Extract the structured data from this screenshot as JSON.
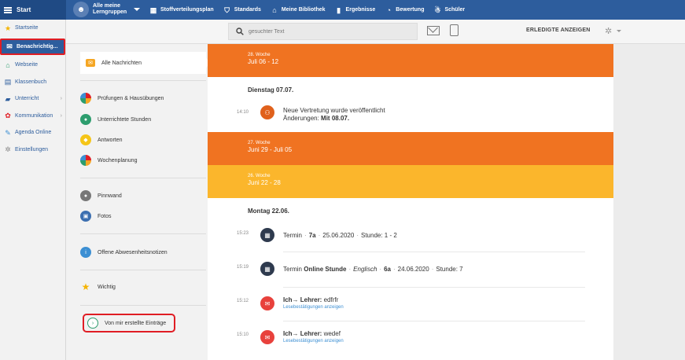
{
  "topbar": {
    "start_label": "Start",
    "gruppen_line1": "Alle meine",
    "gruppen_line2": "Lerngruppen",
    "nav": [
      {
        "label": "Stoffverteilungsplan",
        "icon": "grid-icon"
      },
      {
        "label": "Standards",
        "icon": "shield-icon"
      },
      {
        "label": "Meine Bibliothek",
        "icon": "library-icon"
      },
      {
        "label": "Ergebnisse",
        "icon": "bar-chart-icon"
      },
      {
        "label": "Bewertung",
        "icon": "gauge-icon"
      },
      {
        "label": "Schüler",
        "icon": "students-icon"
      }
    ]
  },
  "sidebar": {
    "items": [
      {
        "label": "Startseite",
        "icon": "star-icon"
      },
      {
        "label": "Benachrichtig...",
        "icon": "envelope-icon"
      },
      {
        "label": "Webseite",
        "icon": "home-icon"
      },
      {
        "label": "Klassenbuch",
        "icon": "book-icon"
      },
      {
        "label": "Unterricht",
        "icon": "folder-icon"
      },
      {
        "label": "Kommunikation",
        "icon": "chat-icon"
      },
      {
        "label": "Agenda Online",
        "icon": "pen-icon"
      },
      {
        "label": "Einstellungen",
        "icon": "gear-icon"
      }
    ]
  },
  "toolbar": {
    "search_placeholder": "gesuchter Text",
    "erledigte": "ERLEDIGTE ANZEIGEN"
  },
  "filters": [
    {
      "label": "Alle Nachrichten"
    },
    {
      "label": "Prüfungen & Hausübungen"
    },
    {
      "label": "Unterrichtete Stunden"
    },
    {
      "label": "Antworten"
    },
    {
      "label": "Wochenplanung"
    },
    {
      "label": "Pinnwand"
    },
    {
      "label": "Fotos"
    },
    {
      "label": "Offene Abwesenheitsnotizen"
    },
    {
      "label": "Wichtig"
    },
    {
      "label": "Von mir erstellte Einträge"
    }
  ],
  "feed": {
    "week28": {
      "label": "28. Woche",
      "range": "Juli 06 - 12"
    },
    "day1": "Dienstag 07.07.",
    "entry1": {
      "time": "14:10",
      "line1": "Neue Vertretung wurde veröffentlicht",
      "line2a": "Änderungen: ",
      "line2b": "Mit 08.07."
    },
    "week27": {
      "label": "27. Woche",
      "range": "Juni 29 - Juli 05"
    },
    "week26": {
      "label": "26. Woche",
      "range": "Juni 22 - 28"
    },
    "day2": "Montag 22.06.",
    "entry2": {
      "time": "15:23",
      "t1": "Termin",
      "t2": "7a",
      "t3": "25.06.2020",
      "t4": "Stunde: 1 - 2"
    },
    "entry3": {
      "time": "15:19",
      "t1": "Termin",
      "t2": "Online Stunde",
      "t3": "Englisch",
      "t4": "6a",
      "t5": "24.06.2020",
      "t6": "Stunde: 7"
    },
    "entry4": {
      "time": "15:12",
      "who": "Ich→ Lehrer:",
      "msg": " edfrfr",
      "sub": "Lesebestätigungen anzeigen"
    },
    "entry5": {
      "time": "15:10",
      "who": "Ich→ Lehrer:",
      "msg": " wedef",
      "sub": "Lesebestätigungen anzeigen"
    }
  },
  "colors": {
    "navy": "#2d5d9d",
    "orange": "#f07321",
    "amber": "#fbb62c",
    "red": "#e01d24"
  }
}
